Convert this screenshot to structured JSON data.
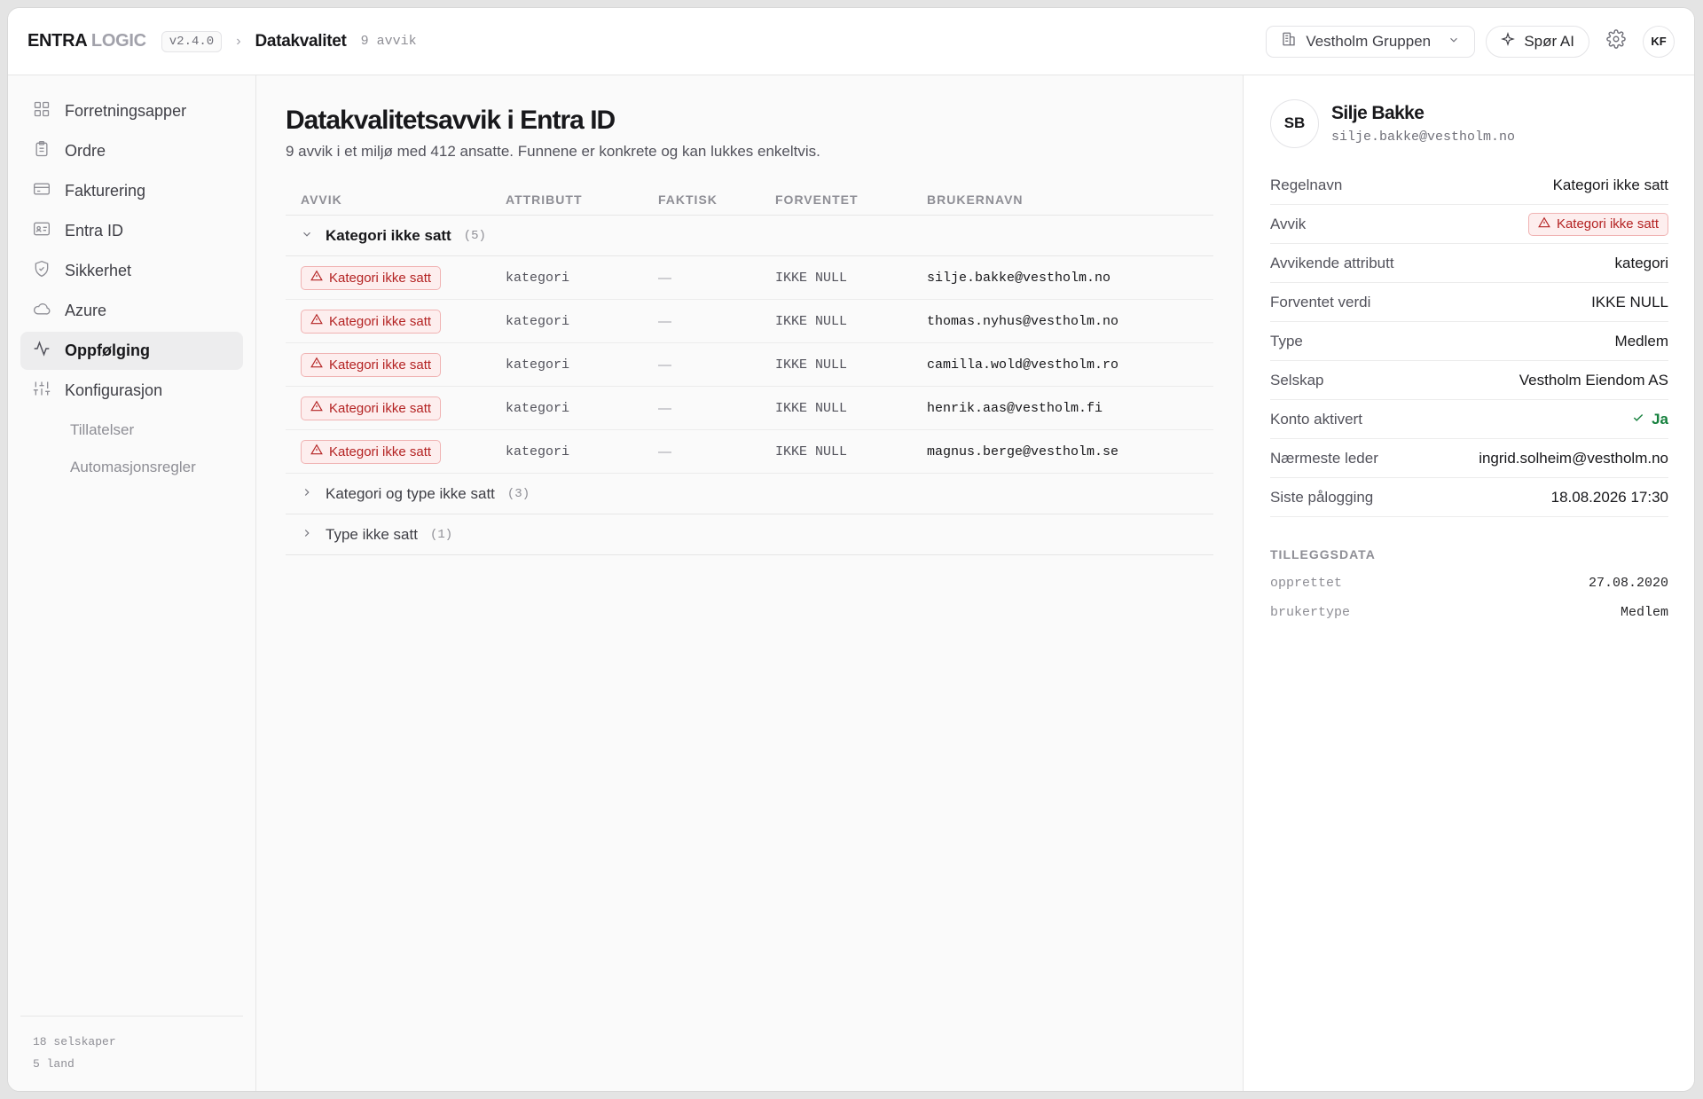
{
  "header": {
    "brand_main": "ENTRA",
    "brand_light": "LOGIC",
    "version": "v2.4.0",
    "page": "Datakvalitet",
    "count": "9 avvik",
    "org": "Vestholm Gruppen",
    "ai_label": "Spør AI",
    "user_initials": "KF"
  },
  "sidebar": {
    "items": [
      {
        "label": "Forretningsapper",
        "icon": "grid-icon"
      },
      {
        "label": "Ordre",
        "icon": "clipboard-icon"
      },
      {
        "label": "Fakturering",
        "icon": "credit-card-icon"
      },
      {
        "label": "Entra ID",
        "icon": "id-card-icon"
      },
      {
        "label": "Sikkerhet",
        "icon": "shield-icon"
      },
      {
        "label": "Azure",
        "icon": "cloud-icon"
      },
      {
        "label": "Oppfølging",
        "icon": "activity-icon"
      },
      {
        "label": "Konfigurasjon",
        "icon": "sliders-icon"
      }
    ],
    "subitems": [
      "Tillatelser",
      "Automasjonsregler"
    ],
    "footer": [
      "18 selskaper",
      "5 land"
    ]
  },
  "main": {
    "title": "Datakvalitetsavvik i Entra ID",
    "subtitle": "9 avvik i et miljø med 412 ansatte. Funnene er konkrete og kan lukkes enkeltvis.",
    "columns": [
      "AVVIK",
      "ATTRIBUTT",
      "FAKTISK",
      "FORVENTET",
      "BRUKERNAVN"
    ],
    "groups": [
      {
        "title": "Kategori ikke satt",
        "count": "(5)"
      },
      {
        "title": "Kategori og type ikke satt",
        "count": "(3)"
      },
      {
        "title": "Type ikke satt",
        "count": "(1)"
      }
    ],
    "rows": [
      {
        "badge": "Kategori ikke satt",
        "attribute": "kategori",
        "actual": "—",
        "expected": "IKKE NULL",
        "user": "silje.bakke@vestholm.no"
      },
      {
        "badge": "Kategori ikke satt",
        "attribute": "kategori",
        "actual": "—",
        "expected": "IKKE NULL",
        "user": "thomas.nyhus@vestholm.no"
      },
      {
        "badge": "Kategori ikke satt",
        "attribute": "kategori",
        "actual": "—",
        "expected": "IKKE NULL",
        "user": "camilla.wold@vestholm.ro"
      },
      {
        "badge": "Kategori ikke satt",
        "attribute": "kategori",
        "actual": "—",
        "expected": "IKKE NULL",
        "user": "henrik.aas@vestholm.fi"
      },
      {
        "badge": "Kategori ikke satt",
        "attribute": "kategori",
        "actual": "—",
        "expected": "IKKE NULL",
        "user": "magnus.berge@vestholm.se"
      }
    ]
  },
  "detail": {
    "initials": "SB",
    "name": "Silje Bakke",
    "email": "silje.bakke@vestholm.no",
    "fields": [
      {
        "key": "Regelnavn",
        "value": "Kategori ikke satt"
      },
      {
        "key": "Avvik",
        "value": "Kategori ikke satt"
      },
      {
        "key": "Avvikende attributt",
        "value": "kategori"
      },
      {
        "key": "Forventet verdi",
        "value": "IKKE NULL"
      },
      {
        "key": "Type",
        "value": "Medlem"
      },
      {
        "key": "Selskap",
        "value": "Vestholm Eiendom AS"
      },
      {
        "key": "Konto aktivert",
        "value": "Ja"
      },
      {
        "key": "Nærmeste leder",
        "value": "ingrid.solheim@vestholm.no"
      },
      {
        "key": "Siste pålogging",
        "value": "18.08.2026 17:30"
      }
    ],
    "extra_title": "TILLEGGSDATA",
    "extra": [
      {
        "key": "opprettet",
        "value": "27.08.2020"
      },
      {
        "key": "brukertype",
        "value": "Medlem"
      }
    ]
  },
  "colors": {
    "accent_danger": "#b42323",
    "danger_bg": "#fdeeee",
    "success": "#15803d"
  }
}
